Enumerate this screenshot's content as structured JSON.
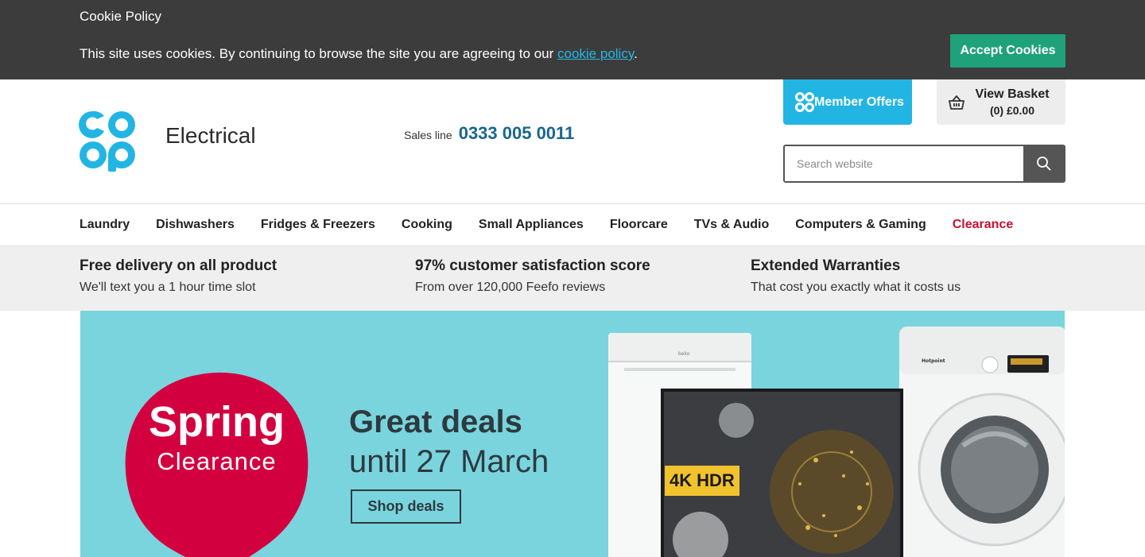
{
  "cookie": {
    "title": "Cookie Policy",
    "text": "This site uses cookies. By continuing to browse the site you are agreeing to our ",
    "link": "cookie policy",
    "end": ".",
    "accept": "Accept Cookies"
  },
  "header": {
    "logo": "co op",
    "brand": "Electrical",
    "sales_label": "Sales line",
    "sales_phone": "0333 005 0011",
    "member_offers": "Member Offers",
    "basket_title": "View Basket",
    "basket_summary": "(0) £0.00",
    "search_placeholder": "Search website"
  },
  "nav": {
    "items": [
      "Laundry",
      "Dishwashers",
      "Fridges & Freezers",
      "Cooking",
      "Small Appliances",
      "Floorcare",
      "TVs & Audio",
      "Computers & Gaming",
      "Clearance"
    ]
  },
  "usps": [
    {
      "title": "Free delivery on all product",
      "sub": "We'll text you a 1 hour time slot"
    },
    {
      "title": "97% customer satisfaction score",
      "sub": "From over 120,000 Feefo reviews"
    },
    {
      "title": "Extended Warranties",
      "sub": "That cost you exactly what it costs us"
    }
  ],
  "hero": {
    "badge_line1": "Spring",
    "badge_line2": "Clearance",
    "headline": "Great deals",
    "subline": "until 27 March",
    "cta": "Shop deals",
    "tv_badge_1": "4K",
    "tv_badge_2": "HDR",
    "fridge_brand": "beko",
    "washer_brand": "Hotpoint"
  },
  "colors": {
    "cookie_bg": "#3c3c3c",
    "accept": "#1fa27a",
    "brand_blue": "#22b5e4",
    "phone": "#18668f",
    "clearance": "#c8102e",
    "hero_bg": "#7ad4de",
    "blob": "#d3003f"
  }
}
